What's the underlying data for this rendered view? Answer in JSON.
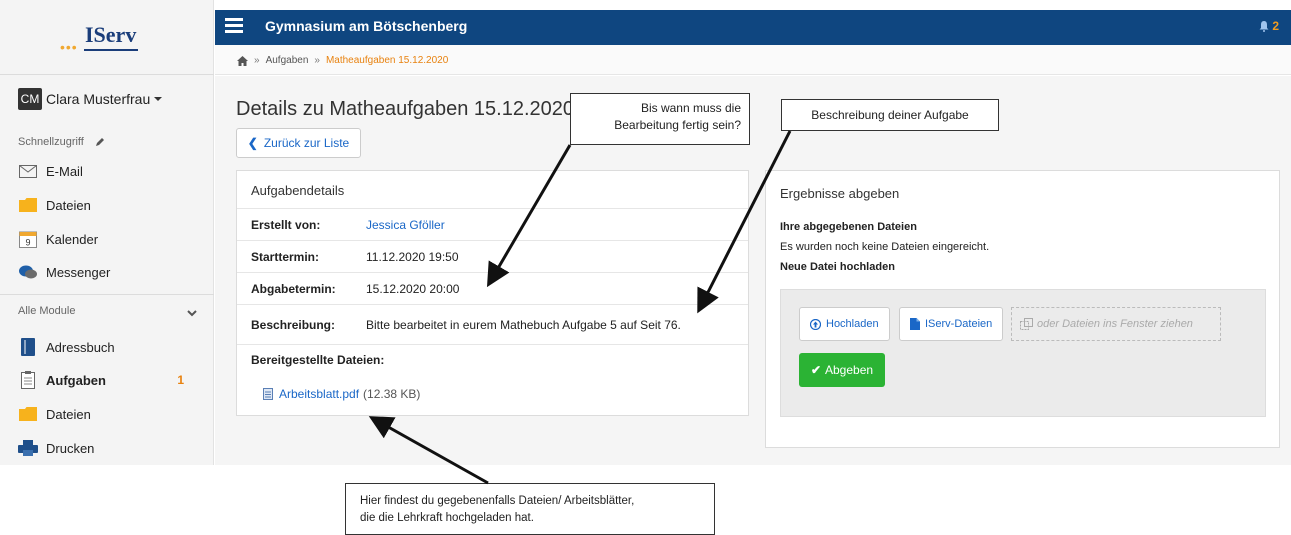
{
  "logo": {
    "text": "IServ"
  },
  "user": {
    "initials": "CM",
    "name": "Clara Musterfrau"
  },
  "sidebar": {
    "quick_access_label": "Schnellzugriff",
    "quick_items": [
      {
        "label": "E-Mail",
        "icon": "envelope-icon"
      },
      {
        "label": "Dateien",
        "icon": "folder-icon"
      },
      {
        "label": "Kalender",
        "icon": "calendar-icon"
      },
      {
        "label": "Messenger",
        "icon": "chat-icon"
      }
    ],
    "modules_label": "Alle Module",
    "module_items": [
      {
        "label": "Adressbuch",
        "icon": "address-book-icon"
      },
      {
        "label": "Aufgaben",
        "icon": "clipboard-icon",
        "badge": "1"
      },
      {
        "label": "Dateien",
        "icon": "folder-icon"
      },
      {
        "label": "Drucken",
        "icon": "printer-icon"
      }
    ]
  },
  "topbar": {
    "school": "Gymnasium am Bötschenberg",
    "notification_count": "2"
  },
  "breadcrumb": {
    "sep": "»",
    "items": [
      "Aufgaben",
      "Matheaufgaben 15.12.2020"
    ]
  },
  "main": {
    "title": "Details zu Matheaufgaben 15.12.2020",
    "back_label": "Zurück zur Liste",
    "details": {
      "heading": "Aufgabendetails",
      "rows": [
        {
          "key": "Erstellt von:",
          "value": "Jessica Gföller"
        },
        {
          "key": "Starttermin:",
          "value": "11.12.2020 19:50"
        },
        {
          "key": "Abgabetermin:",
          "value": "15.12.2020 20:00"
        },
        {
          "key": "Beschreibung:",
          "value": "Bitte bearbeitet in eurem Mathebuch Aufgabe 5 auf Seit 76."
        }
      ],
      "files_label": "Bereitgestellte Dateien:",
      "file_name": "Arbeitsblatt.pdf",
      "file_size": "(12.38 KB)"
    },
    "submit": {
      "heading": "Ergebnisse abgeben",
      "submitted_label": "Ihre abgegebenen Dateien",
      "no_files_text": "Es wurden noch keine Dateien eingereicht.",
      "upload_label": "Neue Datei hochladen",
      "upload_button": "Hochladen",
      "iserv_files_button": "IServ-Dateien",
      "drop_hint": "oder Dateien ins Fenster ziehen",
      "submit_button": "Abgeben"
    }
  },
  "callouts": {
    "deadline_line1": "Bis wann muss die",
    "deadline_line2": "Bearbeitung fertig sein?",
    "description": "Beschreibung deiner Aufgabe",
    "files_line1": "Hier findest du gegebenenfalls Dateien/ Arbeitsblätter,",
    "files_line2": "die die Lehrkraft hochgeladen hat."
  },
  "colors": {
    "nav_bar": "#0f4680",
    "accent": "#e8820f",
    "link": "#1a67c7",
    "submit": "#2bb334"
  }
}
